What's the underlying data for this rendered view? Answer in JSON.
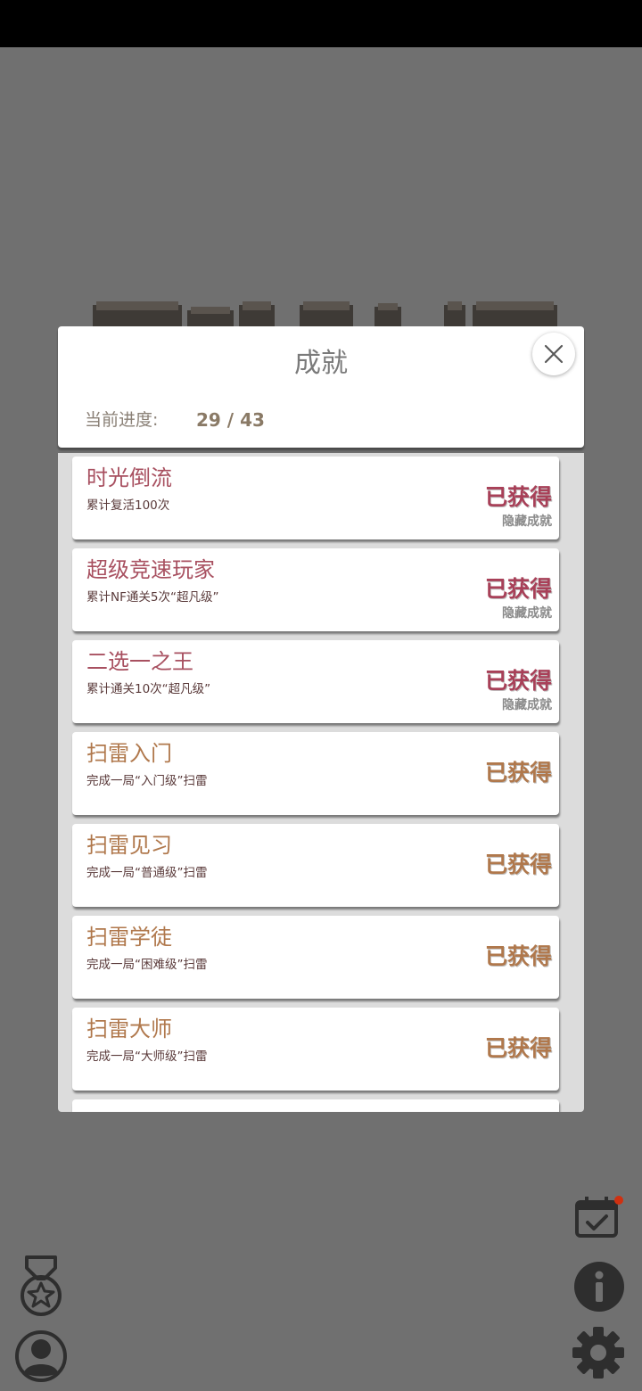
{
  "modal": {
    "title": "成就",
    "progress_label": "当前进度:",
    "progress_value": "29 / 43"
  },
  "achievements": [
    {
      "title": "时光倒流",
      "desc": "累计复活100次",
      "status": "已获得",
      "tag": "隐藏成就",
      "hidden": true
    },
    {
      "title": "超级竞速玩家",
      "desc": "累计NF通关5次“超凡级”",
      "status": "已获得",
      "tag": "隐藏成就",
      "hidden": true
    },
    {
      "title": "二选一之王",
      "desc": "累计通关10次“超凡级”",
      "status": "已获得",
      "tag": "隐藏成就",
      "hidden": true
    },
    {
      "title": "扫雷入门",
      "desc": "完成一局“入门级”扫雷",
      "status": "已获得",
      "tag": "",
      "hidden": false
    },
    {
      "title": "扫雷见习",
      "desc": "完成一局“普通级”扫雷",
      "status": "已获得",
      "tag": "",
      "hidden": false
    },
    {
      "title": "扫雷学徒",
      "desc": "完成一局“困难级”扫雷",
      "status": "已获得",
      "tag": "",
      "hidden": false
    },
    {
      "title": "扫雷大师",
      "desc": "完成一局“大师级”扫雷",
      "status": "已获得",
      "tag": "",
      "hidden": false
    }
  ],
  "icons": {
    "close": "close-icon",
    "calendar": "calendar-check-icon",
    "info": "info-icon",
    "settings": "gear-icon",
    "medal": "medal-icon",
    "user": "user-icon"
  },
  "colors": {
    "hidden_accent": "#a84058",
    "normal_accent": "#b0784c",
    "notification": "#d03010"
  }
}
